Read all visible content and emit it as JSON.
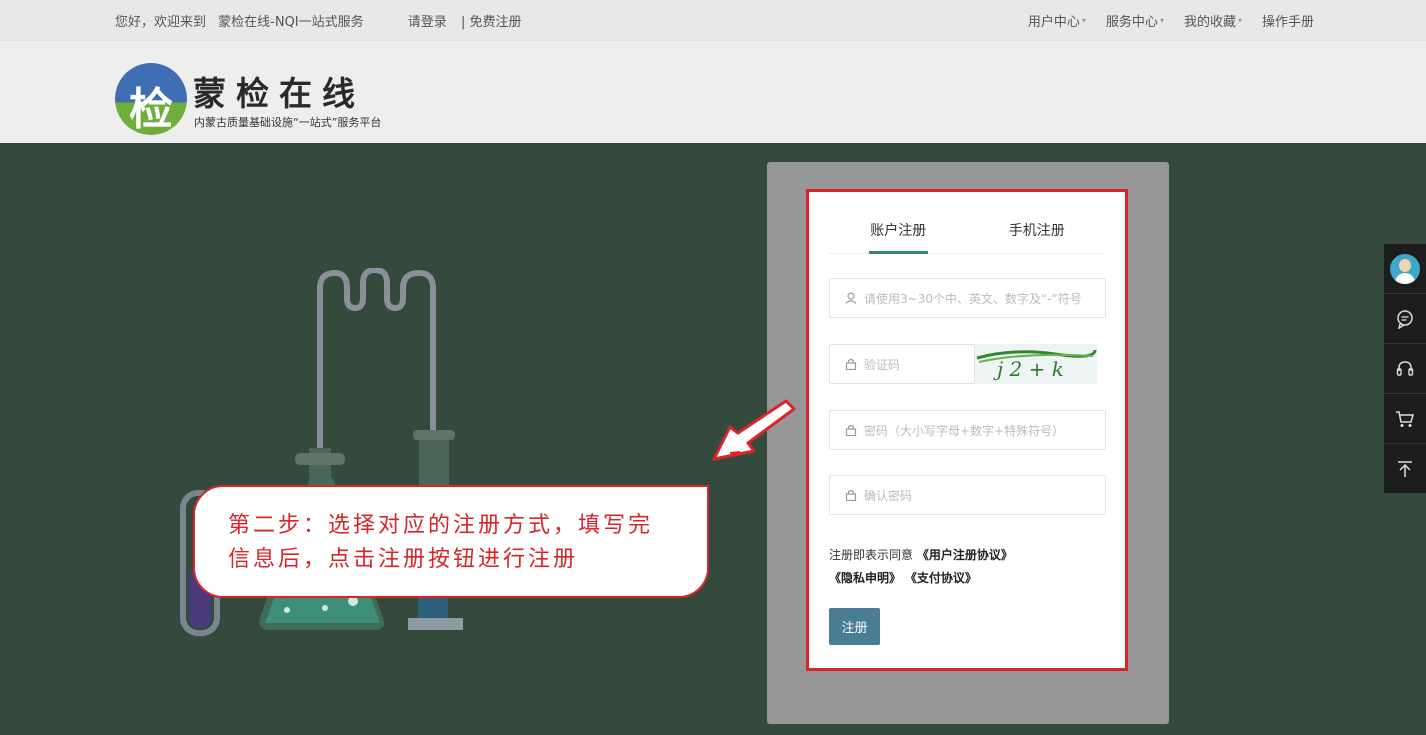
{
  "topbar": {
    "welcome": "您好，欢迎来到",
    "site_name": "蒙检在线-NQI一站式服务",
    "login": "请登录",
    "separator": "|",
    "register": "免费注册",
    "menus": [
      {
        "label": "用户中心",
        "has_dropdown": true
      },
      {
        "label": "服务中心",
        "has_dropdown": true
      },
      {
        "label": "我的收藏",
        "has_dropdown": true
      },
      {
        "label": "操作手册",
        "has_dropdown": false
      }
    ]
  },
  "logo": {
    "title": "蒙检在线",
    "subtitle": "内蒙古质量基础设施“一站式”服务平台",
    "icon": "logo-icon"
  },
  "form": {
    "tabs": [
      {
        "label": "账户注册",
        "active": true
      },
      {
        "label": "手机注册",
        "active": false
      }
    ],
    "fields": {
      "username_placeholder": "请使用3~30个中、英文、数字及“-”符号",
      "captcha_placeholder": "验证码",
      "password_placeholder": "密码（大小写字母+数字+特殊符号）",
      "confirm_placeholder": "确认密码"
    },
    "captcha_text": "j 2 + k",
    "agreement": {
      "prefix": "注册即表示同意",
      "user_agreement": "《用户注册协议》",
      "privacy": "《隐私申明》",
      "payment": "《支付协议》"
    },
    "submit_label": "注册"
  },
  "callout": {
    "line1": "第二步：选择对应的注册方式，填写完",
    "line2": "信息后，点击注册按钮进行注册"
  },
  "sidebar": {
    "icons": [
      "avatar",
      "chat-icon",
      "headset-icon",
      "cart-icon",
      "back-to-top-icon"
    ]
  },
  "colors": {
    "main_bg": "#344a3c",
    "highlight": "#d9252a",
    "button": "#4a7d93",
    "tab_underline": "#3a8a6a"
  }
}
